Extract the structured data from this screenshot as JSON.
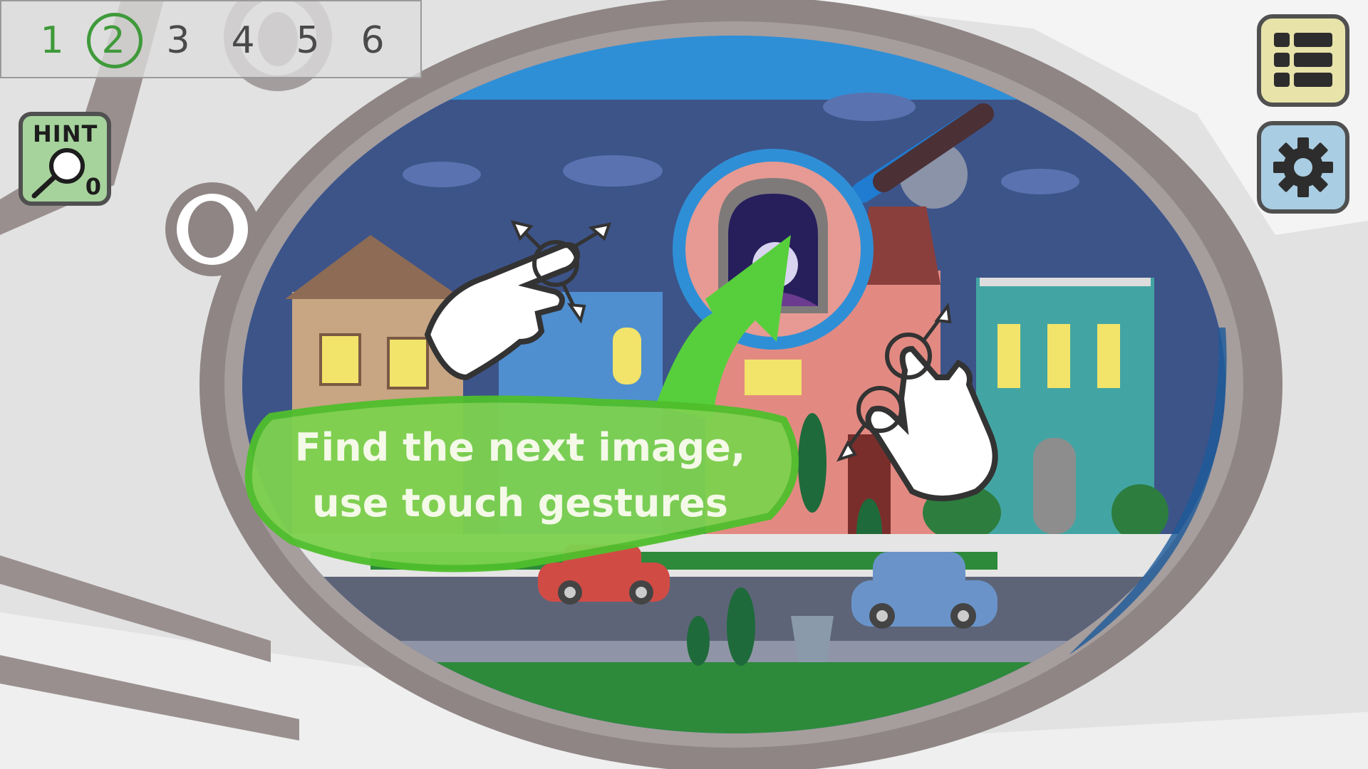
{
  "levels": {
    "items": [
      {
        "label": "1",
        "state": "completed"
      },
      {
        "label": "2",
        "state": "current"
      },
      {
        "label": "3",
        "state": "locked"
      },
      {
        "label": "4",
        "state": "locked"
      },
      {
        "label": "5",
        "state": "locked"
      },
      {
        "label": "6",
        "state": "locked"
      }
    ]
  },
  "hint": {
    "label": "HINT",
    "count": "0",
    "icon": "magnifier-icon"
  },
  "menu": {
    "icon": "list-icon"
  },
  "settings": {
    "icon": "gear-icon"
  },
  "tutorial": {
    "line1": "Find the next image,",
    "line2": "use touch gestures"
  },
  "colors": {
    "level_active": "#3f9a3a",
    "level_locked": "#4a4a4a",
    "hint_bg": "#a6d39c",
    "menu_bg": "#e8e3a9",
    "settings_bg": "#a9cde2",
    "bubble": "#62c93a",
    "night_sky": "#3d5489",
    "frame_blue": "#2f8fd6"
  }
}
